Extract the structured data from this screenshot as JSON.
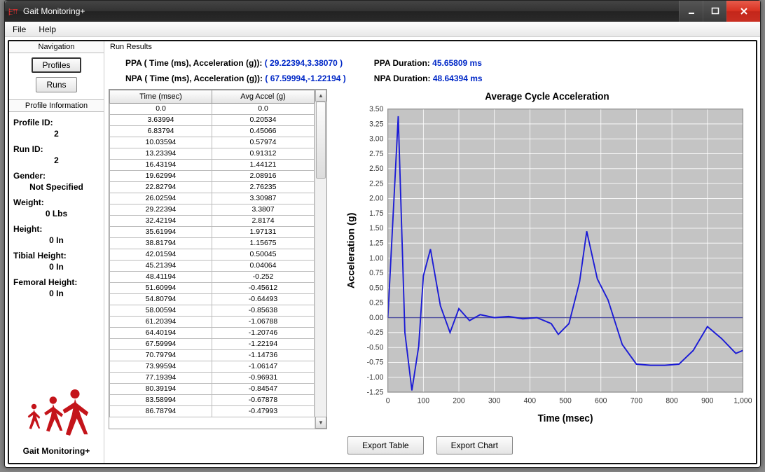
{
  "app": {
    "title": "Gait Monitoring+"
  },
  "menu": {
    "file": "File",
    "help": "Help"
  },
  "nav": {
    "title": "Navigation",
    "profiles": "Profiles",
    "runs": "Runs"
  },
  "profile": {
    "title": "Profile Information",
    "profile_id_label": "Profile ID:",
    "profile_id": "2",
    "run_id_label": "Run ID:",
    "run_id": "2",
    "gender_label": "Gender:",
    "gender": "Not Specified",
    "weight_label": "Weight:",
    "weight": "0 Lbs",
    "height_label": "Height:",
    "height": "0 In",
    "tibial_label": "Tibial Height:",
    "tibial": "0 In",
    "femoral_label": "Femoral Height:",
    "femoral": "0 In"
  },
  "logo": {
    "label": "Gait Monitoring+"
  },
  "results": {
    "title": "Run Results",
    "ppa_label": "PPA ( Time (ms), Acceleration (g)):",
    "ppa_value": "( 29.22394,3.38070 )",
    "npa_label": "NPA ( Time (ms), Acceleration (g)):",
    "npa_value": "( 67.59994,-1.22194 )",
    "ppa_dur_label": "PPA Duration:",
    "ppa_dur_value": "45.65809 ms",
    "npa_dur_label": "NPA Duration:",
    "npa_dur_value": "48.64394 ms"
  },
  "table": {
    "col_time": "Time (msec)",
    "col_accel": "Avg Accel (g)",
    "rows": [
      [
        "0.0",
        "0.0"
      ],
      [
        "3.63994",
        "0.20534"
      ],
      [
        "6.83794",
        "0.45066"
      ],
      [
        "10.03594",
        "0.57974"
      ],
      [
        "13.23394",
        "0.91312"
      ],
      [
        "16.43194",
        "1.44121"
      ],
      [
        "19.62994",
        "2.08916"
      ],
      [
        "22.82794",
        "2.76235"
      ],
      [
        "26.02594",
        "3.30987"
      ],
      [
        "29.22394",
        "3.3807"
      ],
      [
        "32.42194",
        "2.8174"
      ],
      [
        "35.61994",
        "1.97131"
      ],
      [
        "38.81794",
        "1.15675"
      ],
      [
        "42.01594",
        "0.50045"
      ],
      [
        "45.21394",
        "0.04064"
      ],
      [
        "48.41194",
        "-0.252"
      ],
      [
        "51.60994",
        "-0.45612"
      ],
      [
        "54.80794",
        "-0.64493"
      ],
      [
        "58.00594",
        "-0.85638"
      ],
      [
        "61.20394",
        "-1.06788"
      ],
      [
        "64.40194",
        "-1.20746"
      ],
      [
        "67.59994",
        "-1.22194"
      ],
      [
        "70.79794",
        "-1.14736"
      ],
      [
        "73.99594",
        "-1.06147"
      ],
      [
        "77.19394",
        "-0.96931"
      ],
      [
        "80.39194",
        "-0.84547"
      ],
      [
        "83.58994",
        "-0.67878"
      ],
      [
        "86.78794",
        "-0.47993"
      ]
    ]
  },
  "buttons": {
    "export_table": "Export Table",
    "export_chart": "Export Chart"
  },
  "chart_data": {
    "type": "line",
    "title": "Average Cycle Acceleration",
    "xlabel": "Time (msec)",
    "ylabel": "Acceleration (g)",
    "xlim": [
      0,
      1000
    ],
    "ylim": [
      -1.25,
      3.5
    ],
    "xticks": [
      0,
      100,
      200,
      300,
      400,
      500,
      600,
      700,
      800,
      900,
      1000
    ],
    "yticks": [
      -1.25,
      -1.0,
      -0.75,
      -0.5,
      -0.25,
      0.0,
      0.25,
      0.5,
      0.75,
      1.0,
      1.25,
      1.5,
      1.75,
      2.0,
      2.25,
      2.5,
      2.75,
      3.0,
      3.25,
      3.5
    ],
    "series": [
      {
        "name": "Avg Accel",
        "x": [
          0,
          29.2,
          48,
          67.6,
          86.8,
          100,
          120,
          148,
          175,
          200,
          230,
          260,
          300,
          340,
          380,
          420,
          460,
          480,
          510,
          540,
          560,
          590,
          620,
          660,
          700,
          740,
          780,
          820,
          860,
          900,
          940,
          980,
          1000
        ],
        "y": [
          0.0,
          3.38,
          -0.25,
          -1.22,
          -0.48,
          0.7,
          1.15,
          0.2,
          -0.25,
          0.15,
          -0.05,
          0.05,
          0.0,
          0.02,
          -0.02,
          0.0,
          -0.1,
          -0.28,
          -0.1,
          0.6,
          1.45,
          0.65,
          0.3,
          -0.45,
          -0.78,
          -0.8,
          -0.8,
          -0.78,
          -0.55,
          -0.15,
          -0.35,
          -0.6,
          -0.55
        ]
      }
    ]
  }
}
